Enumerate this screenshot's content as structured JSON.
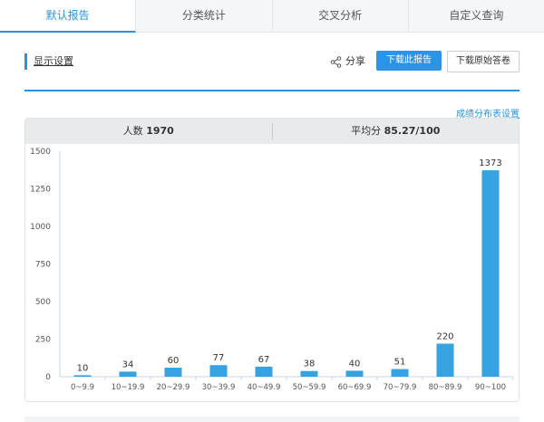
{
  "tabs": [
    {
      "label": "默认报告",
      "active": true
    },
    {
      "label": "分类统计",
      "active": false
    },
    {
      "label": "交叉分析",
      "active": false
    },
    {
      "label": "自定义查询",
      "active": false
    }
  ],
  "toolbar": {
    "settings_label": "显示设置",
    "share_label": "分享",
    "download_report_label": "下载此报告",
    "download_answers_label": "下载原始答卷"
  },
  "distribution_link": "成绩分布表设置",
  "stats": {
    "count_label": "人数",
    "count_value": "1970",
    "avg_label": "平均分",
    "avg_value": "85.27/100"
  },
  "colors": {
    "accent": "#2b93d6",
    "bar": "#36a3e0"
  },
  "chart_data": {
    "type": "bar",
    "categories": [
      "0~9.9",
      "10~19.9",
      "20~29.9",
      "30~39.9",
      "40~49.9",
      "50~59.9",
      "60~69.9",
      "70~79.9",
      "80~89.9",
      "90~100"
    ],
    "values": [
      10,
      34,
      60,
      77,
      67,
      38,
      40,
      51,
      220,
      1373
    ],
    "yticks": [
      0,
      250,
      500,
      750,
      1000,
      1250,
      1500
    ],
    "ylim": [
      0,
      1500
    ],
    "title": "",
    "xlabel": "",
    "ylabel": ""
  }
}
